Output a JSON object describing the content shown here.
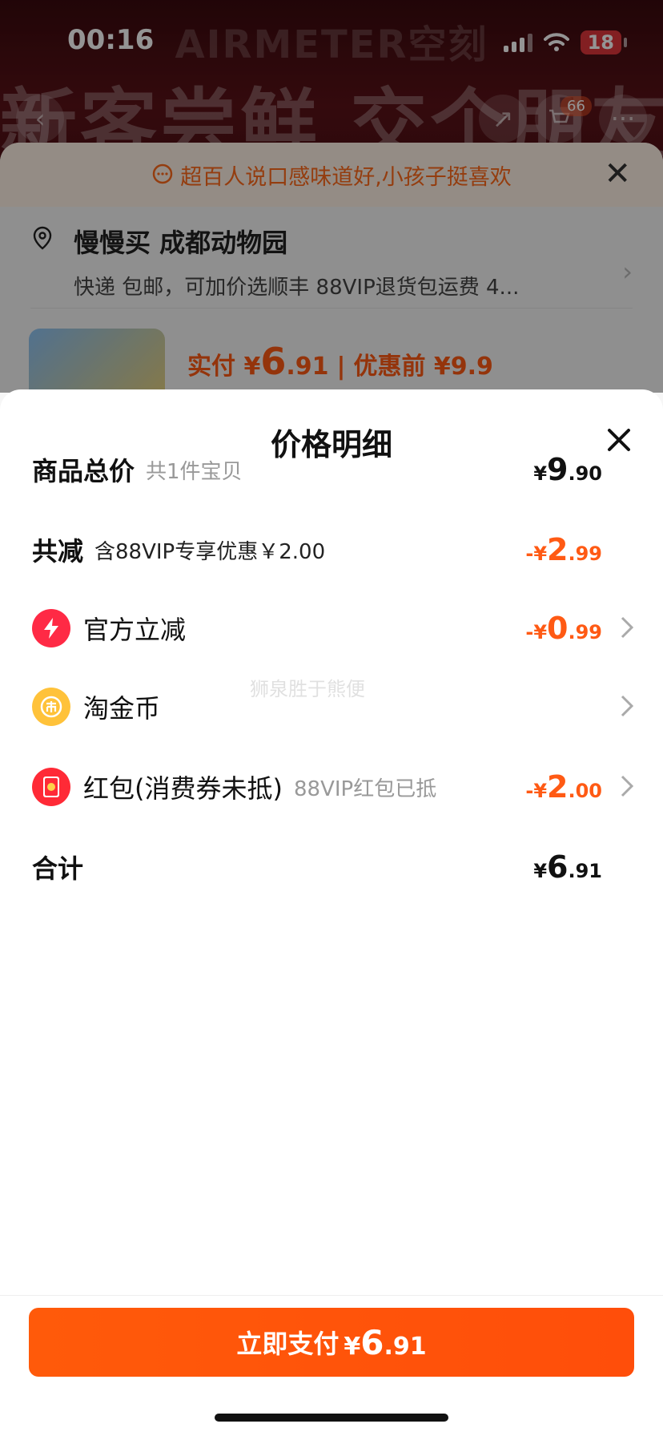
{
  "status_bar": {
    "time": "00:16",
    "battery": "18"
  },
  "background": {
    "brand": "AIRMETER空刻",
    "promo": "新客尝鲜 交个朋友",
    "cart_count": "66",
    "notice": "超百人说口感味道好,小孩子挺喜欢",
    "address_line1": "慢慢买 成都动物园",
    "address_line2": "快递 包邮，可加价选顺丰 88VIP退货包运费 4...",
    "pay_label": "实付 ¥",
    "pay_int": "6",
    "pay_dec": ".91",
    "pay_before": "优惠前 ¥9.9"
  },
  "sheet": {
    "title": "价格明细",
    "rows": [
      {
        "label": "商品总价",
        "note": "共1件宝贝",
        "cur": "¥",
        "int": "9",
        "dec": ".90"
      },
      {
        "label": "共减",
        "note": "含88VIP专享优惠￥2.00",
        "cur": "-¥",
        "int": "2",
        "dec": ".99"
      },
      {
        "label": "官方立减",
        "cur": "-¥",
        "int": "0",
        "dec": ".99"
      },
      {
        "label": "淘金币"
      },
      {
        "label": "红包(消费券未抵)",
        "note": "88VIP红包已抵",
        "cur": "-¥",
        "int": "2",
        "dec": ".00"
      },
      {
        "label": "合计",
        "cur": "¥",
        "int": "6",
        "dec": ".91"
      }
    ],
    "watermark": "狮泉胜于熊便"
  },
  "footer": {
    "pay_text": "立即支付",
    "pay_cur": "¥",
    "pay_int": "6",
    "pay_dec": ".91"
  },
  "colors": {
    "accent": "#ff5a14",
    "bolt": "#ff2a45",
    "coin": "#ffc23a"
  }
}
